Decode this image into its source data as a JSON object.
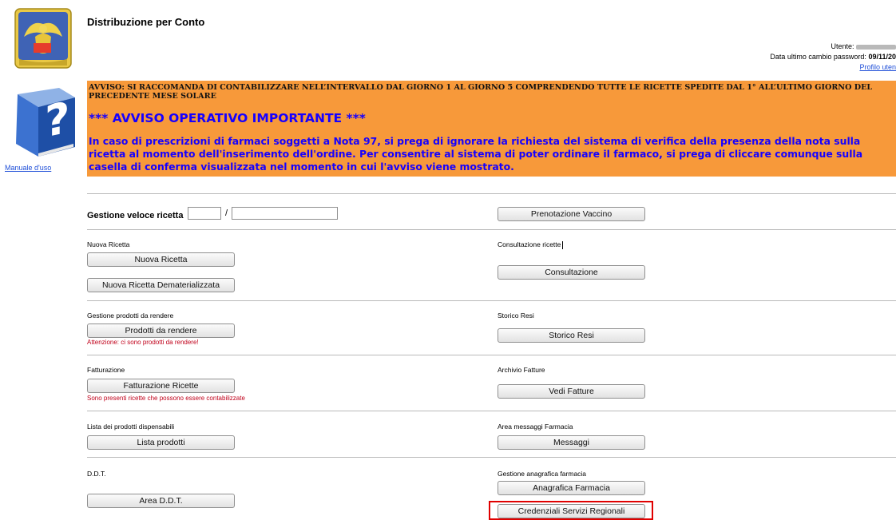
{
  "header": {
    "title": "Distribuzione per Conto",
    "user_label": "Utente:",
    "password_label": "Data ultimo cambio password:",
    "password_date": "09/11/20",
    "profile_link": "Profilo uten"
  },
  "sidebar": {
    "manual_link": "Manuale d'uso"
  },
  "notices": {
    "line1": "AVVISO: SI RACCOMANDA DI CONTABILIZZARE NELL’INTERVALLO DAL GIORNO 1 AL GIORNO 5 COMPRENDENDO TUTTE LE RICETTE SPEDITE DAL 1° ALL’ULTIMO GIORNO DEL PRECEDENTE MESE SOLARE",
    "heading": "*** AVVISO OPERATIVO IMPORTANTE ***",
    "body": "In caso di prescrizioni di farmaci soggetti a Nota 97, si prega di ignorare la richiesta del sistema di verifica della presenza della nota sulla ricetta al momento dell'inserimento dell'ordine. Per consentire al sistema di poter ordinare il farmaco, si prega di cliccare comunque sulla casella di conferma visualizzata nel momento in cui l'avviso viene mostrato."
  },
  "quick": {
    "label": "Gestione veloce ricetta",
    "separator": "/",
    "value1": "",
    "value2": ""
  },
  "sections": {
    "prenotazione_button": "Prenotazione Vaccino",
    "nuova_label": "Nuova Ricetta",
    "nuova_button": "Nuova Ricetta",
    "nuova_demat_button": "Nuova Ricetta Dematerializzata",
    "consultazione_label": "Consultazione ricette",
    "consultazione_button": "Consultazione",
    "rendere_label": "Gestione prodotti da rendere",
    "rendere_button": "Prodotti da rendere",
    "rendere_warning": "Attenzione: ci sono prodotti da rendere!",
    "storico_label": "Storico Resi",
    "storico_button": "Storico Resi",
    "fatt_label": "Fatturazione",
    "fatt_button": "Fatturazione Ricette",
    "fatt_warning": "Sono presenti ricette che possono essere contabilizzate",
    "archivio_label": "Archivio Fatture",
    "archivio_button": "Vedi Fatture",
    "lista_label": "Lista dei prodotti dispensabili",
    "lista_button": "Lista prodotti",
    "messaggi_label": "Area messaggi Farmacia",
    "messaggi_button": "Messaggi",
    "ddt_label": "D.D.T.",
    "ddt_button": "Area D.D.T.",
    "anagrafica_label": "Gestione anagrafica farmacia",
    "anagrafica_button": "Anagrafica Farmacia",
    "credenziali_button": "Credenziali Servizi Regionali"
  },
  "colors": {
    "notice_bg": "#f7993a",
    "notice_text": "#1600ff",
    "link": "#1f4fd8",
    "warning": "#c0001a",
    "highlight": "#e00000"
  },
  "icons": {
    "logo": "regione-veneto-lion-logo",
    "manual": "help-book-icon"
  }
}
